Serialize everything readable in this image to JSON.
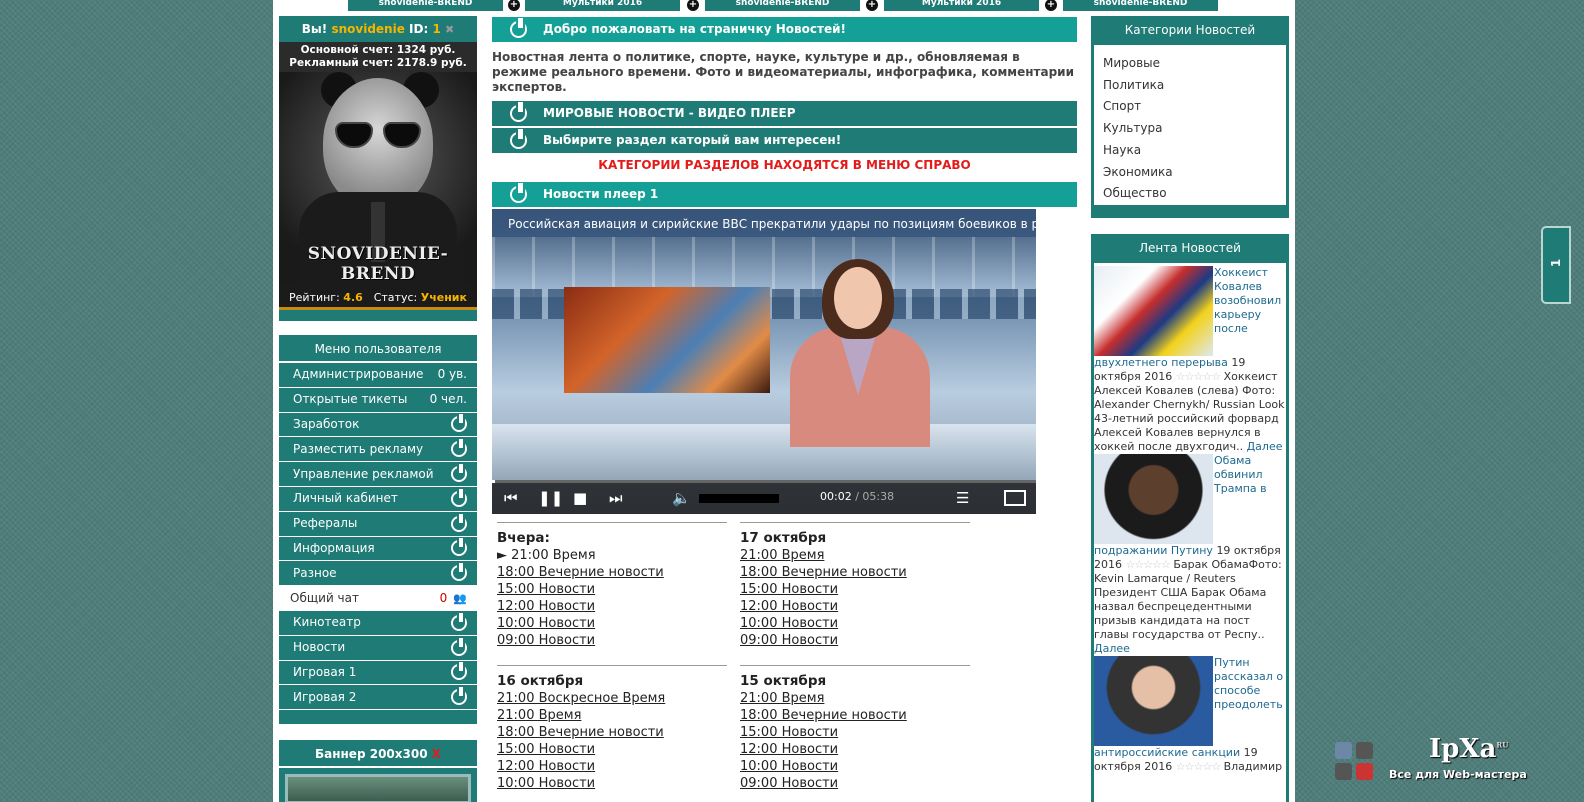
{
  "top_nav": [
    "snovidenie-BREND",
    "Мультики 2016",
    "snovidenie-BREND",
    "Мультики 2016",
    "snovidenie-BREND"
  ],
  "profile": {
    "you_label": "Вы!",
    "nick": "snovidenie",
    "id_label": "ID:",
    "id_value": "1",
    "main_account": "Основной счет: 1324 руб.",
    "ad_account": "Рекламный счет: 2178.9 руб.",
    "avatar_text": "SNOVIDENIE-BREND",
    "rating_label": "Рейтинг:",
    "rating_value": "4.6",
    "status_label": "Статус:",
    "status_value": "Ученик"
  },
  "user_menu": {
    "title": "Меню пользователя",
    "items": [
      {
        "label": "Администрирование",
        "count": "0 ув."
      },
      {
        "label": "Открытые тикеты",
        "count": "0 чел."
      },
      {
        "label": "Заработок",
        "icon": "power-icon"
      },
      {
        "label": "Разместить рекламу",
        "icon": "power-icon"
      },
      {
        "label": "Управление рекламой",
        "icon": "power-icon"
      },
      {
        "label": "Личный кабинет",
        "icon": "power-icon"
      },
      {
        "label": "Рефералы",
        "icon": "power-icon"
      },
      {
        "label": "Информация",
        "icon": "power-icon"
      },
      {
        "label": "Разное",
        "icon": "power-icon"
      },
      {
        "label": "Общий чат",
        "count": "0",
        "icon": "chat-users-icon"
      },
      {
        "label": "Кинотеатр",
        "icon": "power-icon"
      },
      {
        "label": "Новости",
        "icon": "power-icon"
      },
      {
        "label": "Игровая 1",
        "icon": "power-icon"
      },
      {
        "label": "Игровая 2",
        "icon": "power-icon"
      }
    ]
  },
  "banner": {
    "title": "Баннер 200x300",
    "close": "X"
  },
  "main": {
    "welcome": "Добро пожаловать на страничку Новостей!",
    "description": "Новостная лента о политике, спорте, науке, культуре и др., обновляемая в режиме реального времени. Фото и видеоматериалы, инфографика, комментарии экспертов.",
    "world_news": "МИРОВЫЕ НОВОСТИ - ВИДЕО ПЛЕЕР",
    "choose_section": "Выбирите раздел каторый вам интересен!",
    "alert": "КАТЕГОРИИ РАЗДЕЛОВ НАХОДЯТСЯ В МЕНЮ СПРАВО",
    "player_title": "Новости плеер 1"
  },
  "player": {
    "ticker": "Российская авиация и сирийские ВВС прекратили удары по позициям боевиков в районе Алеппо",
    "time_current": "00:02",
    "time_total": "/ 05:38",
    "progress": 0.006,
    "volume": 1.0
  },
  "schedule": [
    {
      "day": "Вчера:",
      "entries": [
        "► 21:00 Время",
        "18:00 Вечерние новости",
        "15:00 Новости",
        "12:00 Новости",
        "10:00 Новости",
        "09:00 Новости"
      ]
    },
    {
      "day": "17 октября",
      "entries": [
        "21:00 Время",
        "18:00 Вечерние новости",
        "15:00 Новости",
        "12:00 Новости",
        "10:00 Новости",
        "09:00 Новости"
      ]
    },
    {
      "day": "16 октября",
      "entries": [
        "21:00 Воскресное Время",
        "21:00 Время",
        "18:00 Вечерние новости",
        "15:00 Новости",
        "12:00 Новости",
        "10:00 Новости"
      ]
    },
    {
      "day": "15 октября",
      "entries": [
        "21:00 Время",
        "18:00 Вечерние новости",
        "15:00 Новости",
        "12:00 Новости",
        "10:00 Новости",
        "09:00 Новости"
      ]
    }
  ],
  "categories": {
    "title": "Категории Новостей",
    "items": [
      "Мировые",
      "Политика",
      "Спорт",
      "Культура",
      "Наука",
      "Экономика",
      "Общество"
    ]
  },
  "feed": {
    "title": "Лента Новостей",
    "items": [
      {
        "title": "Хоккеист Ковалев возобновил карьеру после двухлетнего перерыва",
        "date": "19 октября 2016",
        "text": "Хоккеист Алексей Ковалев (слева) Фото: Alexander Chernykh/ Russian Look 43-летний российский форвард Алексей Ковалев вернулся в хоккей после двухгодич..",
        "more": "Далее"
      },
      {
        "title": "Обама обвинил Трампа в подражании Путину",
        "date": "19 октября 2016",
        "text": "Барак ОбамаФото: Kevin Lamarque / Reuters Президент США Барак Обама назвал беспрецедентными призыв кандидата на пост главы государства от Респу..",
        "more": "Далее"
      },
      {
        "title": "Путин рассказал о способе преодолеть антироссийские санкции",
        "date": "19 октября 2016",
        "text": "Владимир",
        "more": ""
      }
    ]
  },
  "side_tab": "1",
  "ipxa": {
    "logo": "IpXa",
    "logo_sup": "RU",
    "tagline": "Все для Web-мастера"
  }
}
